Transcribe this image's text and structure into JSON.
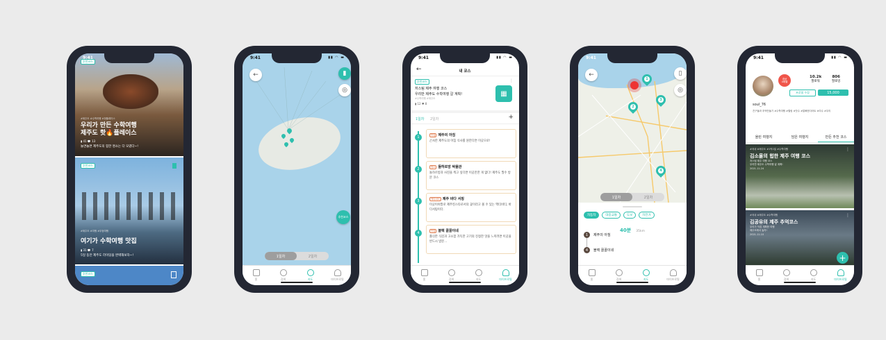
{
  "nav": {
    "home": "홈",
    "search": "검색",
    "map": "지도",
    "my": "마이프로필"
  },
  "common": {
    "time": "9:41",
    "status_icons": "▮▮ ◠ ▬",
    "day1": "1일차",
    "day2": "2일차"
  },
  "phone1": {
    "card1": {
      "meta": "#제주도 #수학여행 #핫플레이스",
      "title": "우리가 만든 수학여행\n제주도 핫🔥플레이스",
      "stats": "▮ 41 💬 13",
      "desc": "놀면놀면 제주도의 힙한 명소는 다 모였다~!"
    },
    "card2": {
      "meta": "#제주도 #여행 #우정여행",
      "title": "여기가 수학여행 맛집",
      "stats": "▮ 31 💬 7",
      "desc": "5일 동안 제주도 라이딩을 완벽해보자~!"
    },
    "tag1": "추천코스",
    "tag2": "추천코스",
    "tag3": "추천코스"
  },
  "phone2": {
    "pin_label": "추천코스"
  },
  "phone3": {
    "header": "내 코스",
    "tag": "추천코스",
    "course_title": "저스팀 제주 여행 코스",
    "course_sub": "우리반 제주도 수학여행 갈 계획!",
    "course_meta": "#수학여행 #제주도",
    "stats": "▮ 12 ♥ 8",
    "add": "+",
    "items": [
      {
        "num": "1",
        "label": "맛집",
        "title": "제주의 아침",
        "desc": "곤사한 제주도의 아침 식사를 원한다면 이곳으로!"
      },
      {
        "num": "2",
        "label": "명소",
        "title": "돌하르방 박물관",
        "desc": "돌하르방과 사진을 찍고 싶다면 이곳만한 게 없다! 제주도 필수 방문 코스"
      },
      {
        "num": "3",
        "label": "액티비티",
        "title": "제주 바다 서핑",
        "desc": "이곳이야말로 제주킹스타로서의 꽃이라고 볼 수 있는 액티비티, 바다서핑이다."
      },
      {
        "num": "4",
        "label": "맛집",
        "title": "블랙 꿀꿀이네",
        "desc": "쫄깃한 식감과 고소함 가득한 고기의 진정한 맛을 느끼려면 이곳을 반드시 방문…"
      }
    ]
  },
  "phone4": {
    "modes": [
      "자동차",
      "대중교통",
      "도보",
      "자전거"
    ],
    "duration": "40분",
    "distance": "35km",
    "stops": [
      {
        "num": "1",
        "name": "제주의 아침"
      },
      {
        "num": "4",
        "name": "블랙 꿀꿀이네"
      }
    ],
    "pins": [
      "1",
      "2",
      "3",
      "4"
    ]
  },
  "phone5": {
    "badge": "경상\n4레벨",
    "followers_n": "10.2k",
    "followers": "팔로워",
    "following_n": "806",
    "following": "팔로잉",
    "edit": "프로필 수정",
    "points": "15,000",
    "username": "soul_76",
    "bio": "친구들과 추억만들기 #수학여행 #힐링 #맛수 #알빠한다라트 #여수 #우리",
    "tabs": [
      "올린 여행지",
      "담은 여행지",
      "만든 추천 코스"
    ],
    "card1": {
      "meta": "#국내 #제주도 #1박2일 #수학여행",
      "title": "김소울의 힙한 제주 여행 코스",
      "sub": "저스팀 제주 여행 코스\n우리반 제주도 수학여행 갈 계획!",
      "date": "2021.11.24"
    },
    "card2": {
      "meta": "#국내 #제주도 #수학여행",
      "title": "김공유의 제주 추억코스",
      "sub": "우리가 직접 계획한 여행\n제주도에서 놀자!",
      "date": "2021.11.10"
    },
    "fab": "+"
  },
  "colors": {
    "accent": "#2ebfae",
    "phone": "#232733",
    "background": "#ebebeb"
  }
}
